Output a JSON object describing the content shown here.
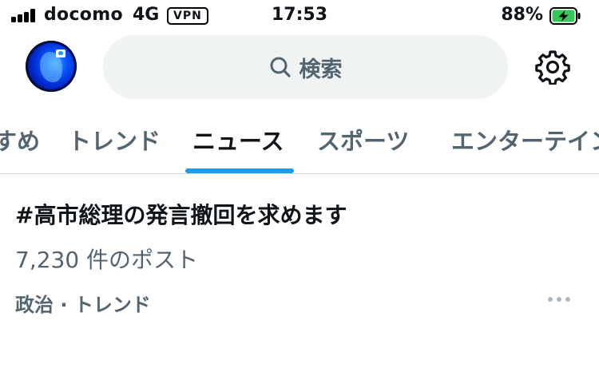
{
  "status_bar": {
    "carrier": "docomo",
    "network": "4G",
    "vpn": "VPN",
    "time": "17:53",
    "battery_percent": "88%",
    "battery_level": 0.88,
    "battery_color": "#34c759",
    "battery_state": "charging",
    "signal_bars": 4
  },
  "header": {
    "avatar_icon": "profile-avatar",
    "search_icon": "magnifier",
    "search_placeholder": "検索",
    "settings_icon": "gear"
  },
  "tabs": [
    {
      "label": "すめ",
      "active": false
    },
    {
      "label": "トレンド",
      "active": false
    },
    {
      "label": "ニュース",
      "active": true
    },
    {
      "label": "スポーツ",
      "active": false
    },
    {
      "label": "エンターテイン",
      "active": false
    }
  ],
  "accent_color": "#1d9bf0",
  "trend": {
    "title": "#高市総理の発言撤回を求めます",
    "post_count": "7,230 件のポスト",
    "category": "政治 · トレンド",
    "more_icon": "ellipsis"
  }
}
